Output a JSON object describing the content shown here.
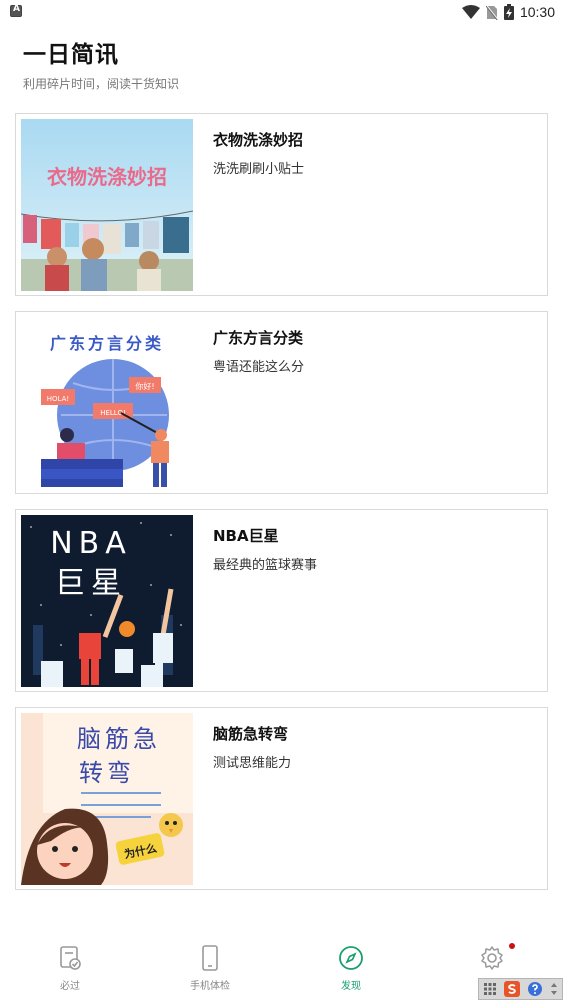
{
  "status_bar": {
    "time": "10:30",
    "left_icon": "a-notification-icon",
    "icons": [
      "wifi-icon",
      "no-sim-icon",
      "battery-charging-icon"
    ]
  },
  "header": {
    "title": "一日简讯",
    "subtitle": "利用碎片时间，阅读干货知识"
  },
  "cards": [
    {
      "title": "衣物洗涤妙招",
      "description": "洗洗刷刷小贴士",
      "thumb_text": "衣物洗涤妙招"
    },
    {
      "title": "广东方言分类",
      "description": "粤语还能这么分",
      "thumb_text": "广东方言分类",
      "bubbles": [
        "HOLA!",
        "HELLO!",
        "你好!"
      ]
    },
    {
      "title": "NBA巨星",
      "description": "最经典的篮球赛事",
      "thumb_text_line1": "NBA",
      "thumb_text_line2": "巨星"
    },
    {
      "title": "脑筋急转弯",
      "description": "测试思维能力",
      "thumb_text_line1": "脑筋急",
      "thumb_text_line2": "转弯",
      "sticker": "为什么"
    }
  ],
  "bottom_nav": [
    {
      "label": "必过",
      "icon": "checklist-icon",
      "active": false
    },
    {
      "label": "手机体检",
      "icon": "phone-icon",
      "active": false
    },
    {
      "label": "发现",
      "icon": "compass-icon",
      "active": true
    },
    {
      "label": "",
      "icon": "gear-icon",
      "active": false
    }
  ],
  "colors": {
    "accent": "#1a9e6e",
    "inactive": "#888888",
    "badge": "#cc1111"
  }
}
